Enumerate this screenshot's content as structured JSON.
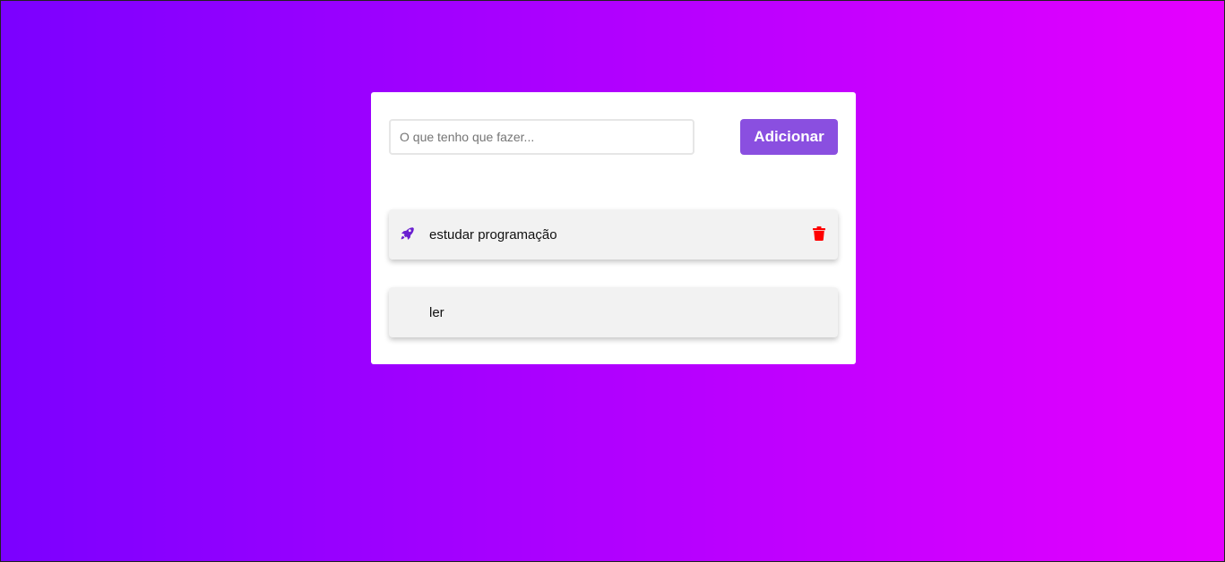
{
  "form": {
    "input_placeholder": "O que tenho que fazer...",
    "input_value": "",
    "add_button_label": "Adicionar"
  },
  "tasks": [
    {
      "label": "estudar programação",
      "icon": "rocket-icon",
      "has_delete": true
    },
    {
      "label": "ler",
      "icon": null,
      "has_delete": false
    }
  ],
  "colors": {
    "background_gradient_start": "#7b00ff",
    "background_gradient_end": "#e600ff",
    "button": "#8a4fe0",
    "rocket_icon": "#6a1fd0",
    "trash_icon": "#ff0000"
  }
}
